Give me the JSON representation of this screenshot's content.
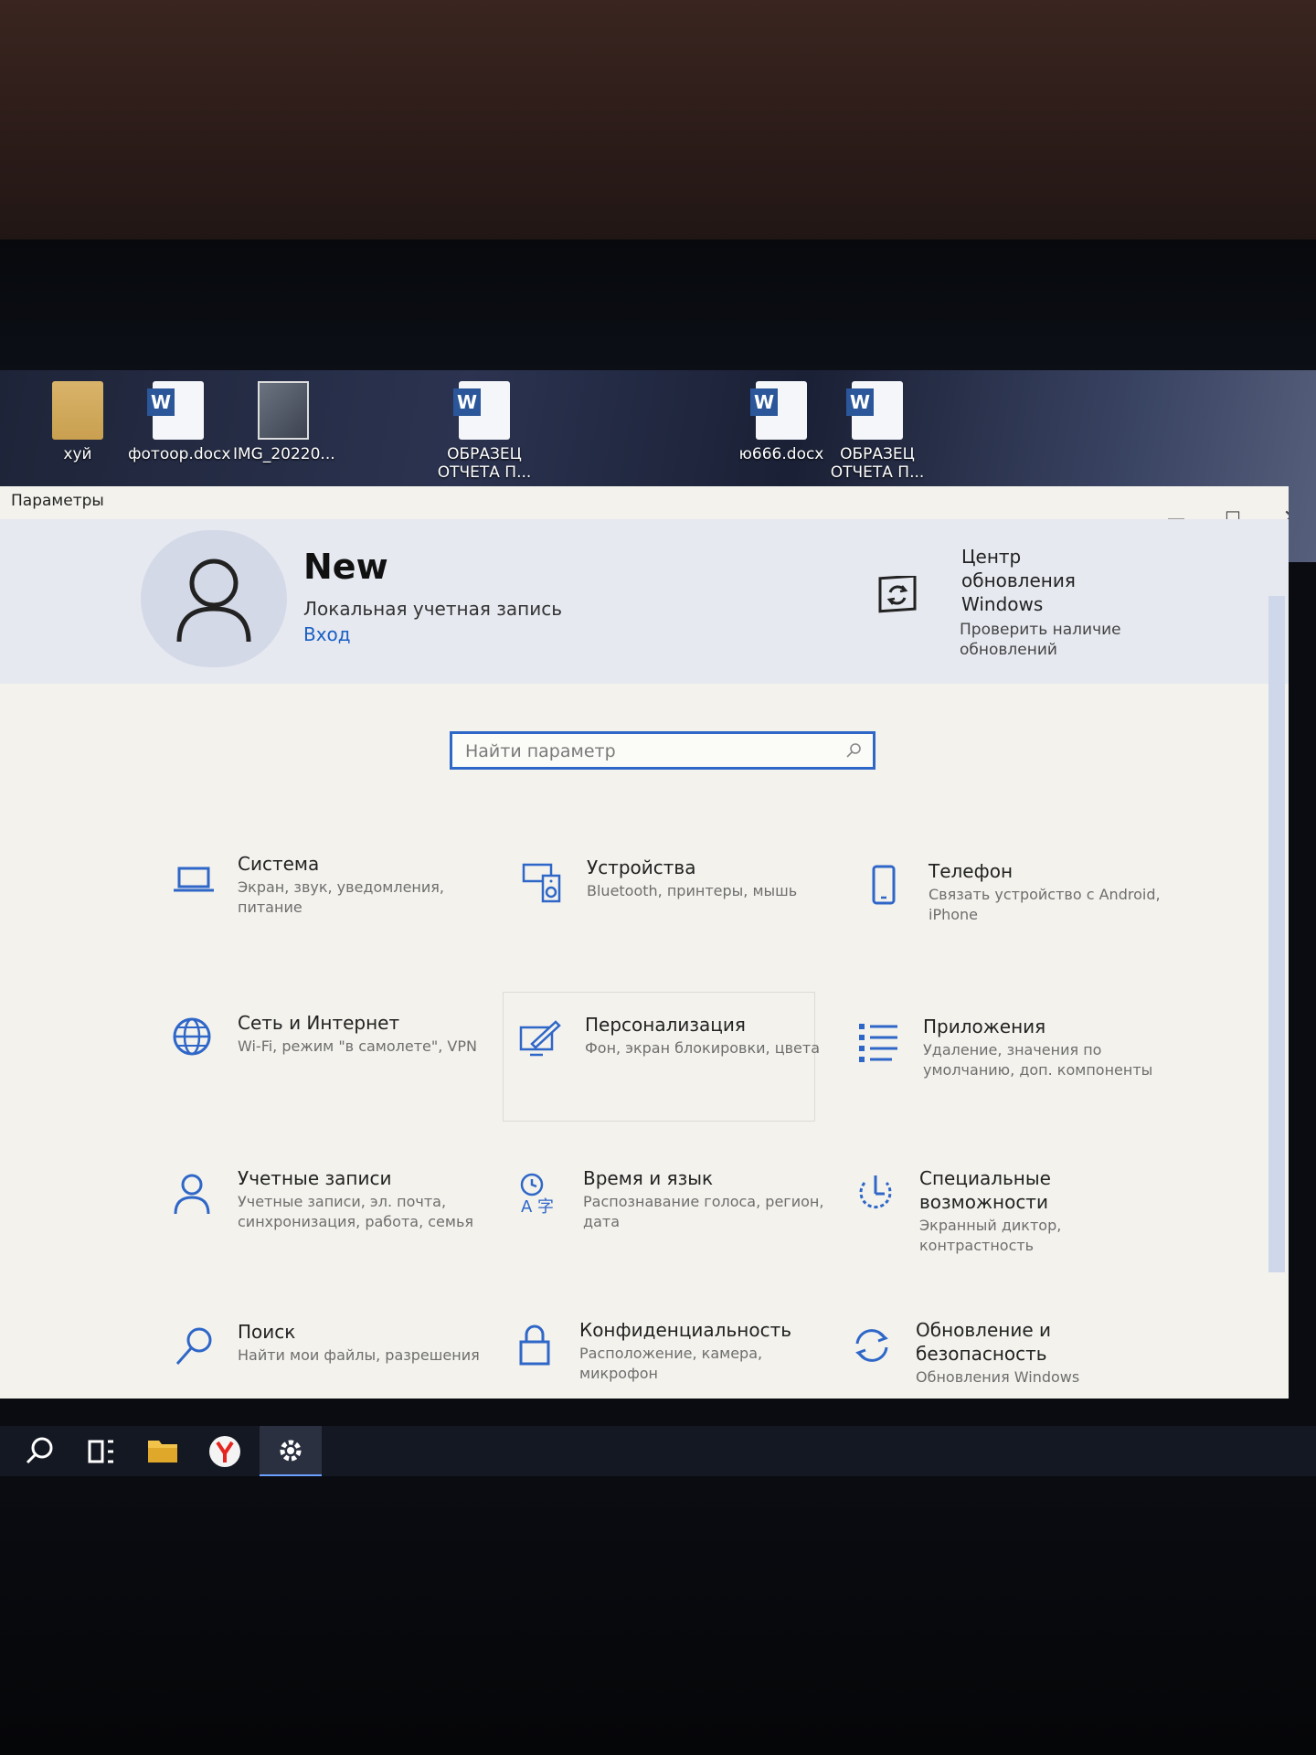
{
  "desktop": {
    "icons": [
      {
        "label": "хуй",
        "kind": "folder"
      },
      {
        "label": "фотоор.docx",
        "kind": "word"
      },
      {
        "label": "IMG_20220...",
        "kind": "photo"
      },
      {
        "label": "ОБРАЗЕЦ ОТЧЕТА П...",
        "kind": "word"
      },
      {
        "label": "ю666.docx",
        "kind": "word"
      },
      {
        "label": "ОБРАЗЕЦ ОТЧЕТА П...",
        "kind": "word"
      }
    ]
  },
  "window": {
    "title": "Параметры",
    "controls": {
      "minimize": "—",
      "maximize": "☐",
      "close": "✕"
    }
  },
  "header": {
    "user_name": "New",
    "account_type": "Локальная учетная запись",
    "login_link": "Вход",
    "update_title": "Центр обновления Windows",
    "update_subtitle": "Проверить наличие обновлений"
  },
  "search": {
    "placeholder": "Найти параметр"
  },
  "tiles": [
    {
      "title": "Система",
      "subtitle": "Экран, звук, уведомления, питание",
      "icon": "laptop-icon"
    },
    {
      "title": "Устройства",
      "subtitle": "Bluetooth, принтеры, мышь",
      "icon": "devices-icon"
    },
    {
      "title": "Телефон",
      "subtitle": "Связать устройство с Android, iPhone",
      "icon": "phone-icon"
    },
    {
      "title": "Сеть и Интернет",
      "subtitle": "Wi-Fi, режим \"в самолете\", VPN",
      "icon": "globe-icon"
    },
    {
      "title": "Персонализация",
      "subtitle": "Фон, экран блокировки, цвета",
      "icon": "brush-icon"
    },
    {
      "title": "Приложения",
      "subtitle": "Удаление, значения по умолчанию, доп. компоненты",
      "icon": "apps-list-icon"
    },
    {
      "title": "Учетные записи",
      "subtitle": "Учетные записи, эл. почта, синхронизация, работа, семья",
      "icon": "person-icon"
    },
    {
      "title": "Время и язык",
      "subtitle": "Распознавание голоса, регион, дата",
      "icon": "time-language-icon"
    },
    {
      "title": "Специальные возможности",
      "subtitle": "Экранный диктор, контрастность",
      "icon": "accessibility-icon"
    },
    {
      "title": "Поиск",
      "subtitle": "Найти мои файлы, разрешения",
      "icon": "search-icon"
    },
    {
      "title": "Конфиденциальность",
      "subtitle": "Расположение, камера, микрофон",
      "icon": "lock-icon"
    },
    {
      "title": "Обновление и безопасность",
      "subtitle": "Обновления Windows",
      "icon": "sync-icon"
    }
  ],
  "taskbar": {
    "items": [
      "search-icon",
      "task-view-icon",
      "file-explorer-icon",
      "yandex-browser-icon",
      "settings-gear-icon"
    ]
  },
  "colors": {
    "accent": "#1a5fc4",
    "window_bg": "#f3f2ed",
    "header_bg": "#e6e9f0",
    "icon_blue": "#2f67c8"
  }
}
